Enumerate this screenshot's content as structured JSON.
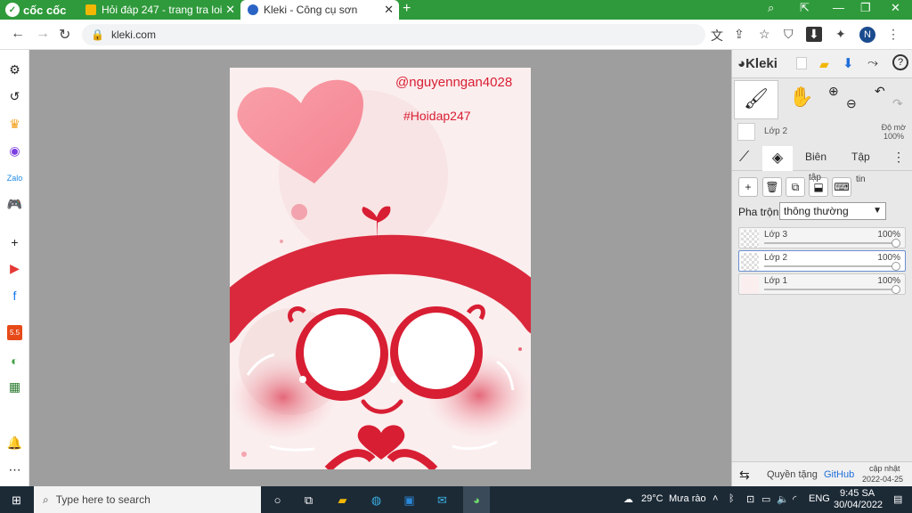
{
  "browser": {
    "brand": "cốc cốc",
    "tabs": [
      {
        "title": "Hỏi đáp 247 - trang tra loi",
        "active": false
      },
      {
        "title": "Kleki - Công cụ sơn",
        "active": true
      }
    ],
    "url": "kleki.com",
    "profile_initial": "N"
  },
  "kleki": {
    "logo": "Kleki",
    "layer_header": {
      "name": "Lớp 2",
      "opacity_label": "Độ mờ",
      "opacity_value": "100%"
    },
    "tabs": {
      "edit": "Biên",
      "file": "Tập",
      "file_sub": "tập",
      "file_sub2": "tin"
    },
    "blend": {
      "label": "Pha trộn",
      "value": "thông thường"
    },
    "layers": [
      {
        "name": "Lớp 3",
        "opacity": "100%",
        "selected": false
      },
      {
        "name": "Lớp 2",
        "opacity": "100%",
        "selected": true
      },
      {
        "name": "Lớp 1",
        "opacity": "100%",
        "selected": false
      }
    ],
    "footer": {
      "privacy": "Quyền tặng",
      "github": "GitHub",
      "update": "cập nhật",
      "date": "2022-04-25"
    }
  },
  "artwork": {
    "handle": "@nguyenngan4028",
    "tag": "#Hoidap247",
    "accent": "#d81e33"
  },
  "taskbar": {
    "search_placeholder": "Type here to search",
    "weather_temp": "29°C",
    "weather_desc": "Mưa rào",
    "lang": "ENG",
    "time": "9:45 SA",
    "date": "30/04/2022"
  }
}
